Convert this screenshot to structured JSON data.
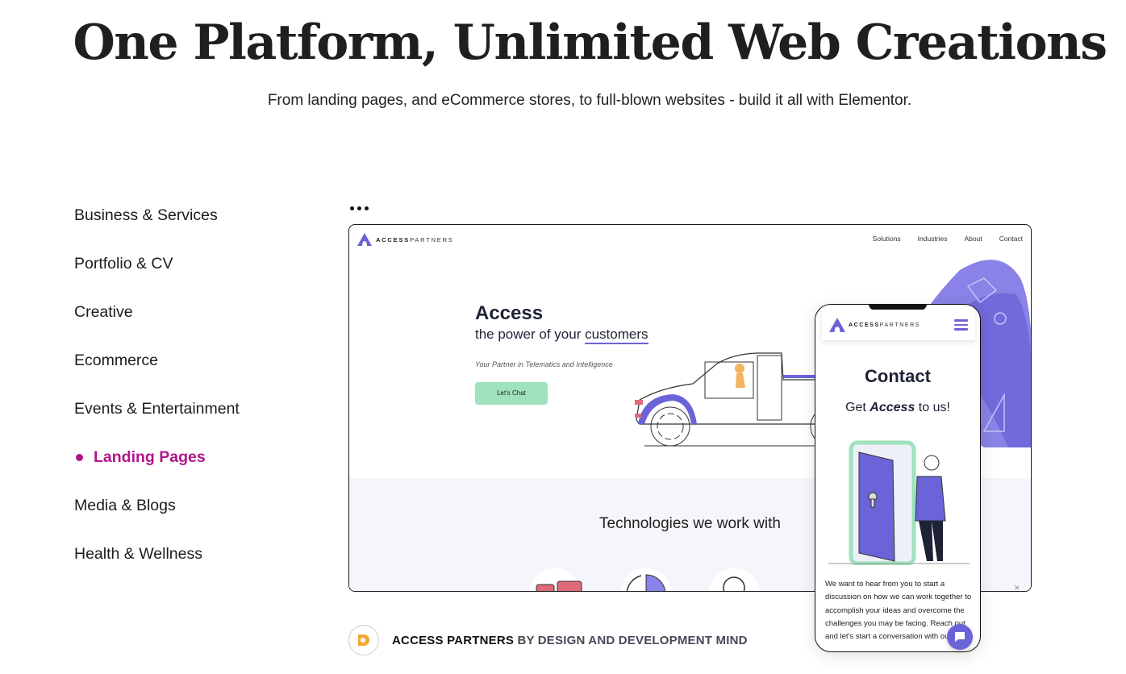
{
  "hero": {
    "title": "One Platform, Unlimited Web Creations",
    "subtitle": "From landing pages, and eCommerce stores, to full-blown websites - build it all with Elementor."
  },
  "categories": {
    "items": [
      {
        "label": "Business & Services",
        "active": false
      },
      {
        "label": "Portfolio & CV",
        "active": false
      },
      {
        "label": "Creative",
        "active": false
      },
      {
        "label": "Ecommerce",
        "active": false
      },
      {
        "label": "Events & Entertainment",
        "active": false
      },
      {
        "label": "Landing Pages",
        "active": true
      },
      {
        "label": "Media & Blogs",
        "active": false
      },
      {
        "label": "Health & Wellness",
        "active": false
      }
    ],
    "active_color": "#b0168a"
  },
  "preview": {
    "logo_bold": "ACCESS",
    "logo_light": "PARTNERS",
    "nav": [
      "Solutions",
      "Industries",
      "About",
      "Contact"
    ],
    "headline": "Access",
    "subheadline_prefix": "the power of your ",
    "subheadline_underlined": "customers",
    "tagline": "Your Partner in Telematics and Intelligence",
    "cta": "Let's Chat",
    "section_title": "Technologies we work with",
    "accent_color": "#6b63d8",
    "cta_color": "#9fe2bd"
  },
  "mobile": {
    "logo_bold": "ACCESS",
    "logo_light": "PARTNERS",
    "title": "Contact",
    "sub_prefix": "Get ",
    "sub_em": "Access",
    "sub_suffix": " to us!",
    "body": "We want to hear from you to start a discussion on how we can work together to accomplish your ideas and overcome the challenges you may be facing. Reach out and let's start a conversation with our team."
  },
  "credit": {
    "name": "ACCESS PARTNERS",
    "by": " BY DESIGN AND DEVELOPMENT MIND",
    "logo_color": "#f0a830"
  }
}
